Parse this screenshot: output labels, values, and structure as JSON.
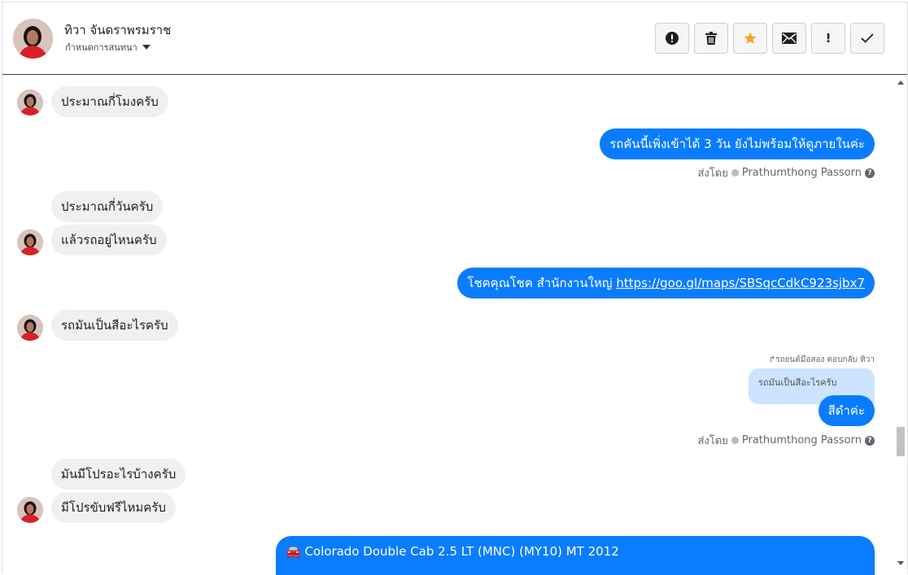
{
  "header": {
    "name": "ทิวา จันดราพรมราช",
    "subtitle": "กำหนดการสนทนา"
  },
  "toolbar": [
    {
      "name": "report-button",
      "icon": "alert-circle-icon"
    },
    {
      "name": "delete-button",
      "icon": "trash-icon"
    },
    {
      "name": "star-button",
      "icon": "star-icon"
    },
    {
      "name": "mail-button",
      "icon": "envelope-icon"
    },
    {
      "name": "important-button",
      "icon": "exclamation-icon"
    },
    {
      "name": "done-button",
      "icon": "checkmark-icon"
    }
  ],
  "messages": {
    "m1": "ประมาณกี่โมงครับ",
    "m2": "รถคันนี้เพิ่งเข้าได้ 3 วัน ยังไม่พร้อมให้ดูภายในค่ะ",
    "m3": "ประมาณกี่วันครับ",
    "m4": "แล้วรถอยู่ไหนครับ",
    "m5_text": "โชคคุณโชค สำนักงานใหญ่",
    "m5_link": "https://goo.gl/maps/SBSqcCdkC923sjbx7",
    "m6": "รถมันเป็นสีอะไรครับ",
    "reply_hint": "รถยนต์มือสอง ตอบกลับ ทิวา",
    "quote": "รถมันเป็นสีอะไรครับ",
    "m7": "สีดำค่ะ",
    "m8": "มันมีโปรอะไรบ้างครับ",
    "m9": "มีโปรขับฟรีไหมครับ",
    "card": "🚘 Colorado Double Cab 2.5 LT (MNC) (MY10) MT 2012"
  },
  "sent_by": {
    "prefix": "ส่งโดย",
    "agent": "Prathumthong Passorn"
  },
  "colors": {
    "outgoing": "#0a7cff",
    "incoming": "#f1f0f0",
    "star": "#f5a623"
  }
}
